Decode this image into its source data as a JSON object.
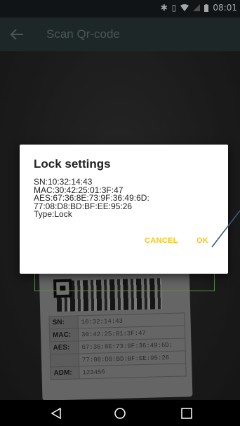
{
  "status_bar": {
    "time": "08:01"
  },
  "toolbar": {
    "title": "Scan Qr-code"
  },
  "label_card": {
    "rows": [
      {
        "key": "SN:",
        "value": "10:32:14:43"
      },
      {
        "key": "MAC:",
        "value": "30:42:25:01:3F:47"
      },
      {
        "key": "AES:",
        "value": "67:36:8E:73:9F:36:49:6D:"
      },
      {
        "key": "",
        "value": "77:08:D8:BD:BF:EE:95:26"
      },
      {
        "key": "ADM:",
        "value": "123456"
      }
    ]
  },
  "dialog": {
    "title": "Lock settings",
    "lines": [
      "SN:10:32:14:43",
      "MAC:30:42:25:01:3F:47",
      "AES:67:36:8E:73:9F:36:49:6D:",
      "77:08:D8:BD:BF:EE:95:26",
      "Type:Lock"
    ],
    "cancel_label": "CANCEL",
    "ok_label": "OK"
  },
  "colors": {
    "accent": "#f5c518",
    "toolbar": "#2f3c3c",
    "pointer_line": "#3d5a7a"
  }
}
